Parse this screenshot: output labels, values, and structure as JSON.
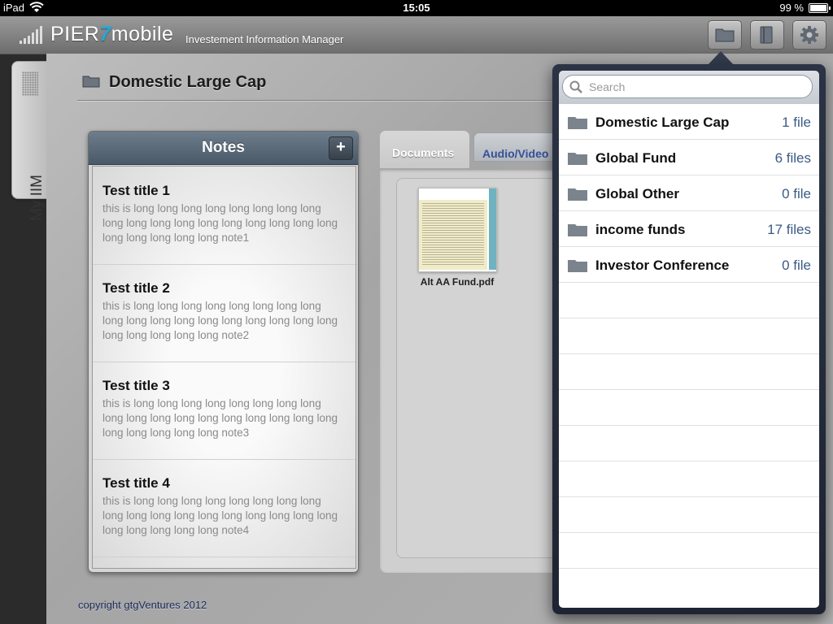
{
  "status_bar": {
    "device": "iPad",
    "time": "15:05",
    "battery": "99 %",
    "battery_level": 0.99
  },
  "app": {
    "logo_pre": "PIER",
    "logo_seven": "7",
    "logo_post": "mobile",
    "subtitle": "Investement Information Manager"
  },
  "toolbar": {
    "buttons": [
      "folder-icon",
      "book-icon",
      "gear-icon"
    ]
  },
  "side_tab": {
    "label": "My IIM"
  },
  "page": {
    "title": "Domestic Large Cap"
  },
  "notes": {
    "title": "Notes",
    "add_label": "+",
    "items": [
      {
        "title": "Test title 1",
        "body": "this is long long long long long long long long long long long long long long long long long long long long long long long note1"
      },
      {
        "title": "Test title 2",
        "body": "this is long long long long long long long long long long long long long long long long long long long long long long long note2"
      },
      {
        "title": "Test title 3",
        "body": "this is long long long long long long long long long long long long long long long long long long long long long long long note3"
      },
      {
        "title": "Test title 4",
        "body": "this is long long long long long long long long long long long long long long long long long long long long long long long note4"
      }
    ]
  },
  "tabs": {
    "documents": "Documents",
    "audio_video": "Audio/Video"
  },
  "documents": [
    {
      "name": "Alt AA Fund.pdf"
    }
  ],
  "footer": {
    "copyright": "copyright gtgVentures 2012"
  },
  "popover": {
    "search_placeholder": "Search",
    "folders": [
      {
        "name": "Domestic Large Cap",
        "count": "1 file"
      },
      {
        "name": "Global Fund",
        "count": "6 files"
      },
      {
        "name": "Global Other",
        "count": "0 file"
      },
      {
        "name": "income funds",
        "count": "17 files"
      },
      {
        "name": "Investor Conference",
        "count": "0 file"
      }
    ]
  },
  "colors": {
    "accent": "#27a6d8",
    "count_text": "#3a5a86",
    "notes_header": "#4a5968"
  }
}
